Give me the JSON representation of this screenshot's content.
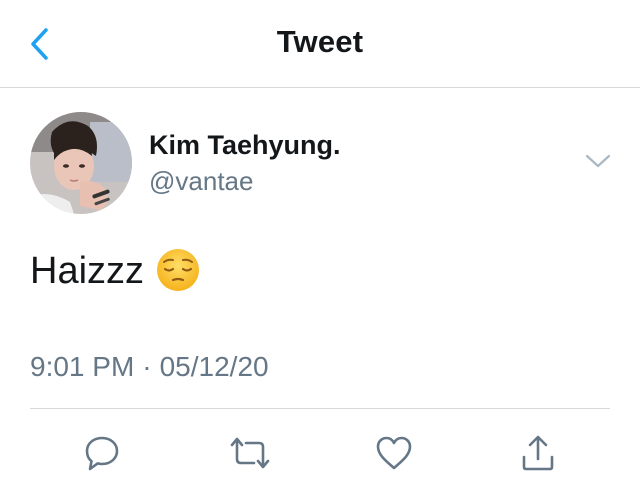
{
  "header": {
    "title": "Tweet",
    "back_icon": "chevron-left-icon"
  },
  "tweet": {
    "author_name": "Kim Taehyung.",
    "author_handle": "@vantae",
    "text": "Haizzz",
    "emoji": "pensive-face-emoji",
    "time": "9:01 PM",
    "separator": "·",
    "date": "05/12/20"
  },
  "actions": [
    {
      "name": "reply",
      "icon": "comment-bubble-icon"
    },
    {
      "name": "retweet",
      "icon": "retweet-icon"
    },
    {
      "name": "like",
      "icon": "heart-icon"
    },
    {
      "name": "share",
      "icon": "share-icon"
    }
  ],
  "colors": {
    "accent": "#1da1f2",
    "text": "#14171a",
    "secondary": "#657786",
    "divider": "#d6d9dc",
    "icon": "#657786"
  }
}
